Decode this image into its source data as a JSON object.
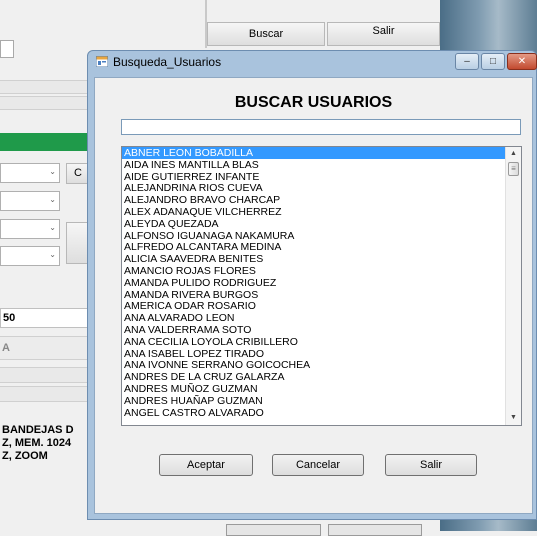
{
  "background": {
    "top_buttons": {
      "buscar": "Buscar",
      "salir": "Salir"
    },
    "combo_arrow": "⌄",
    "partial_button_letter": "C",
    "number_label": "50",
    "letter_label": "A",
    "info_lines": [
      "BANDEJAS D",
      "Z, MEM. 1024",
      "Z, ZOOM"
    ]
  },
  "dialog": {
    "title": "Busqueda_Usuarios",
    "heading": "BUSCAR USUARIOS",
    "search": {
      "value": "",
      "placeholder": ""
    },
    "users": [
      "ABNER LEON BOBADILLA",
      "AIDA INES MANTILLA BLAS",
      "AIDE GUTIERREZ INFANTE",
      "ALEJANDRINA RIOS CUEVA",
      "ALEJANDRO BRAVO CHARCAP",
      "ALEX ADANAQUE VILCHERREZ",
      "ALEYDA QUEZADA",
      "ALFONSO IGUANAGA NAKAMURA",
      "ALFREDO ALCANTARA MEDINA",
      "ALICIA SAAVEDRA BENITES",
      "AMANCIO ROJAS FLORES",
      "AMANDA PULIDO RODRIGUEZ",
      "AMANDA RIVERA BURGOS",
      "AMERICA ODAR ROSARIO",
      "ANA ALVARADO LEON",
      "ANA VALDERRAMA SOTO",
      "ANA CECILIA LOYOLA CRIBILLERO",
      "ANA ISABEL LOPEZ TIRADO",
      "ANA IVONNE SERRANO GOICOCHEA",
      "ANDRES DE LA CRUZ GALARZA",
      "ANDRES MUÑOZ GUZMAN",
      "ANDRES HUAÑAP GUZMAN",
      "ANGEL CASTRO ALVARADO"
    ],
    "selected_index": 0,
    "buttons": {
      "aceptar": "Aceptar",
      "cancelar": "Cancelar",
      "salir": "Salir"
    },
    "window_controls": {
      "minimize": "–",
      "maximize": "□",
      "close": "✕"
    },
    "scroll_glyphs": {
      "up": "▲",
      "down": "▼",
      "thumb": "≡"
    }
  },
  "colors": {
    "selection": "#3399ff",
    "frame": "#a9c3dd",
    "accent_green": "#1f9a4a"
  }
}
